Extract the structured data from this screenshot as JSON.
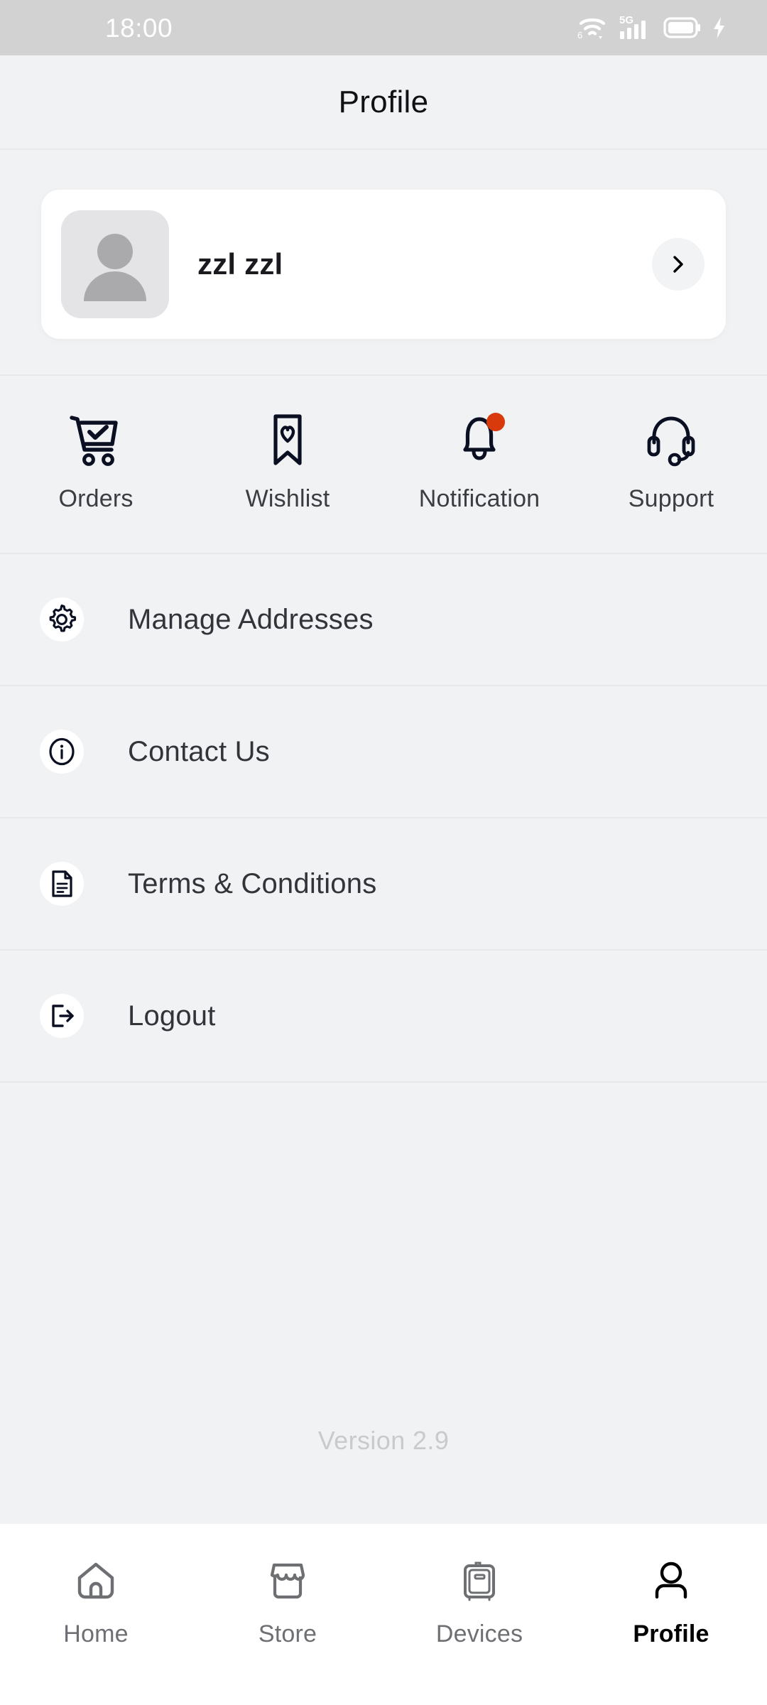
{
  "status_bar": {
    "time": "18:00",
    "icons": [
      "wifi-6-icon",
      "5g-signal-icon",
      "battery-icon",
      "charging-bolt-icon"
    ],
    "network_label": "5G",
    "wifi_label": "6",
    "background_color": "#D2D2D2",
    "text_color": "#FFFFFF"
  },
  "header": {
    "title": "Profile"
  },
  "profile_card": {
    "name": "zzl zzl",
    "avatar_icon": "person-placeholder-icon",
    "chevron_icon": "chevron-right-icon"
  },
  "quick_actions": [
    {
      "label": "Orders",
      "icon": "shopping-cart-check-icon",
      "badge": false
    },
    {
      "label": "Wishlist",
      "icon": "bookmark-heart-icon",
      "badge": false
    },
    {
      "label": "Notification",
      "icon": "bell-icon",
      "badge": true,
      "badge_color": "#D93A0B"
    },
    {
      "label": "Support",
      "icon": "headset-icon",
      "badge": false
    }
  ],
  "menu_items": [
    {
      "label": "Manage Addresses",
      "icon": "gear-icon"
    },
    {
      "label": "Contact Us",
      "icon": "info-circle-icon"
    },
    {
      "label": "Terms & Conditions",
      "icon": "document-icon"
    },
    {
      "label": "Logout",
      "icon": "logout-icon"
    }
  ],
  "footer": {
    "version": "Version 2.9"
  },
  "bottom_nav": {
    "active": "Profile",
    "items": [
      {
        "label": "Home",
        "icon": "home-icon",
        "active": false
      },
      {
        "label": "Store",
        "icon": "store-icon",
        "active": false
      },
      {
        "label": "Devices",
        "icon": "devices-icon",
        "active": false
      },
      {
        "label": "Profile",
        "icon": "person-icon",
        "active": true
      }
    ]
  },
  "theme": {
    "background": "#F1F2F4",
    "card_background": "#FFFFFF",
    "divider": "#E7E8EA",
    "text_primary": "#1A1B1F",
    "text_secondary": "#6E6F73",
    "accent_badge": "#D93A0B"
  }
}
